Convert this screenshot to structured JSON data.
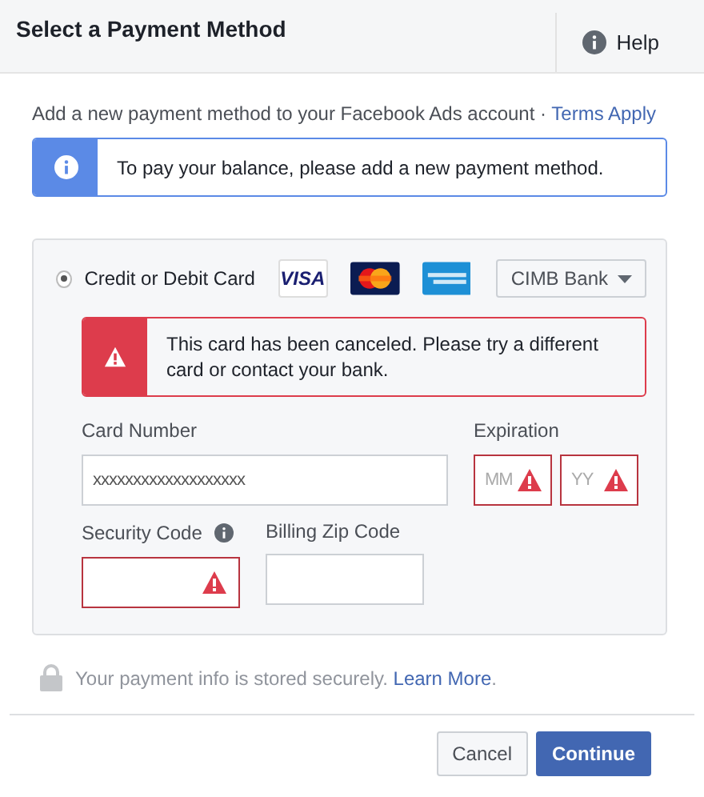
{
  "dialog": {
    "title": "Select a Payment Method",
    "help": "Help"
  },
  "intro": {
    "text": "Add a new payment method to your Facebook Ads account ·",
    "link": "Terms Apply"
  },
  "info_notice": "To pay your balance, please add a new payment method.",
  "payment_option": {
    "label": "Credit or Debit Card",
    "selected": true,
    "card_brands": [
      {
        "kind": "visa",
        "label": "VISA"
      },
      {
        "kind": "mastercard"
      },
      {
        "kind": "amex"
      }
    ],
    "bank_select": "CIMB Bank"
  },
  "error_notice": "This card has been canceled. Please try a different card or contact your bank.",
  "fields": {
    "card_number": {
      "label": "Card Number",
      "value": "xxxxxxxxxxxxxxxxxxx",
      "invalid": false
    },
    "expiration": {
      "label": "Expiration",
      "month": {
        "placeholder": "MM",
        "invalid": true
      },
      "year": {
        "placeholder": "YY",
        "invalid": true
      }
    },
    "security_code": {
      "label": "Security Code",
      "invalid": true
    },
    "zip": {
      "label": "Billing Zip Code",
      "invalid": false
    }
  },
  "secure_note": {
    "text": "Your payment info is stored securely.",
    "link": "Learn More",
    "suffix": "."
  },
  "buttons": [
    {
      "kind": "secondary",
      "label": "Cancel"
    },
    {
      "kind": "primary",
      "label": "Continue"
    }
  ]
}
